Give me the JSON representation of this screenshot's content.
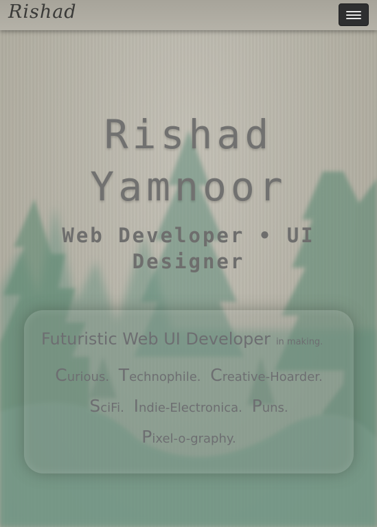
{
  "navbar": {
    "brand": "Rishad",
    "toggle_icon": "hamburger-menu-icon"
  },
  "hero": {
    "name_line1": "Rishad",
    "name_line2": "Yamnoor",
    "role_line1": "Web Developer • UI",
    "role_line2": "Designer"
  },
  "card": {
    "title": "Futuristic Web UI Developer",
    "subtitle": "in making.",
    "traits": [
      {
        "cap": "C",
        "rest": "urious."
      },
      {
        "cap": "T",
        "rest": "echnophile."
      },
      {
        "cap": "C",
        "rest": "reative-Hoarder."
      },
      {
        "cap": "S",
        "rest": "ciFi."
      },
      {
        "cap": "I",
        "rest": "ndie-Electronica."
      },
      {
        "cap": "P",
        "rest": "uns."
      },
      {
        "cap": "P",
        "rest": "ixel-o-graphy."
      }
    ]
  },
  "colors": {
    "background": "#b3b0a4",
    "tree": "#5f8a73",
    "text": "#6d6e71",
    "toggle": "#2e2f30"
  }
}
